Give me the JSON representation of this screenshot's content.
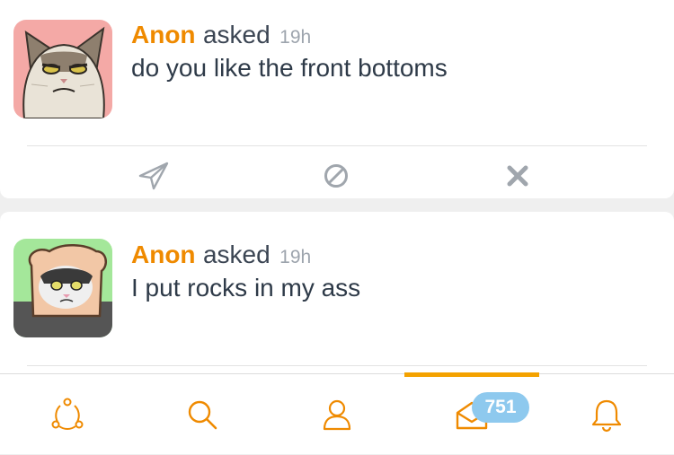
{
  "questions": [
    {
      "author": "Anon",
      "verb": "asked",
      "time": "19h",
      "text": "do you like the front bottoms",
      "avatar": "grumpy-cat-avatar",
      "actions": [
        "answer-icon",
        "block-icon",
        "delete-icon"
      ]
    },
    {
      "author": "Anon",
      "verb": "asked",
      "time": "19h",
      "text": "I put rocks in my ass",
      "avatar": "cat-in-bread-avatar"
    }
  ],
  "tabbar": {
    "tabs": [
      {
        "name": "network",
        "icon": "network-icon"
      },
      {
        "name": "search",
        "icon": "search-icon"
      },
      {
        "name": "profile",
        "icon": "profile-icon"
      },
      {
        "name": "inbox",
        "icon": "inbox-icon",
        "active": true
      },
      {
        "name": "notifications",
        "icon": "bell-icon"
      }
    ],
    "inbox_badge": "751"
  },
  "colors": {
    "accent": "#ef8a00",
    "active_indicator": "#f4a200",
    "badge": "#8ec9ee",
    "text": "#2e3a48",
    "muted": "#9da4ad"
  }
}
